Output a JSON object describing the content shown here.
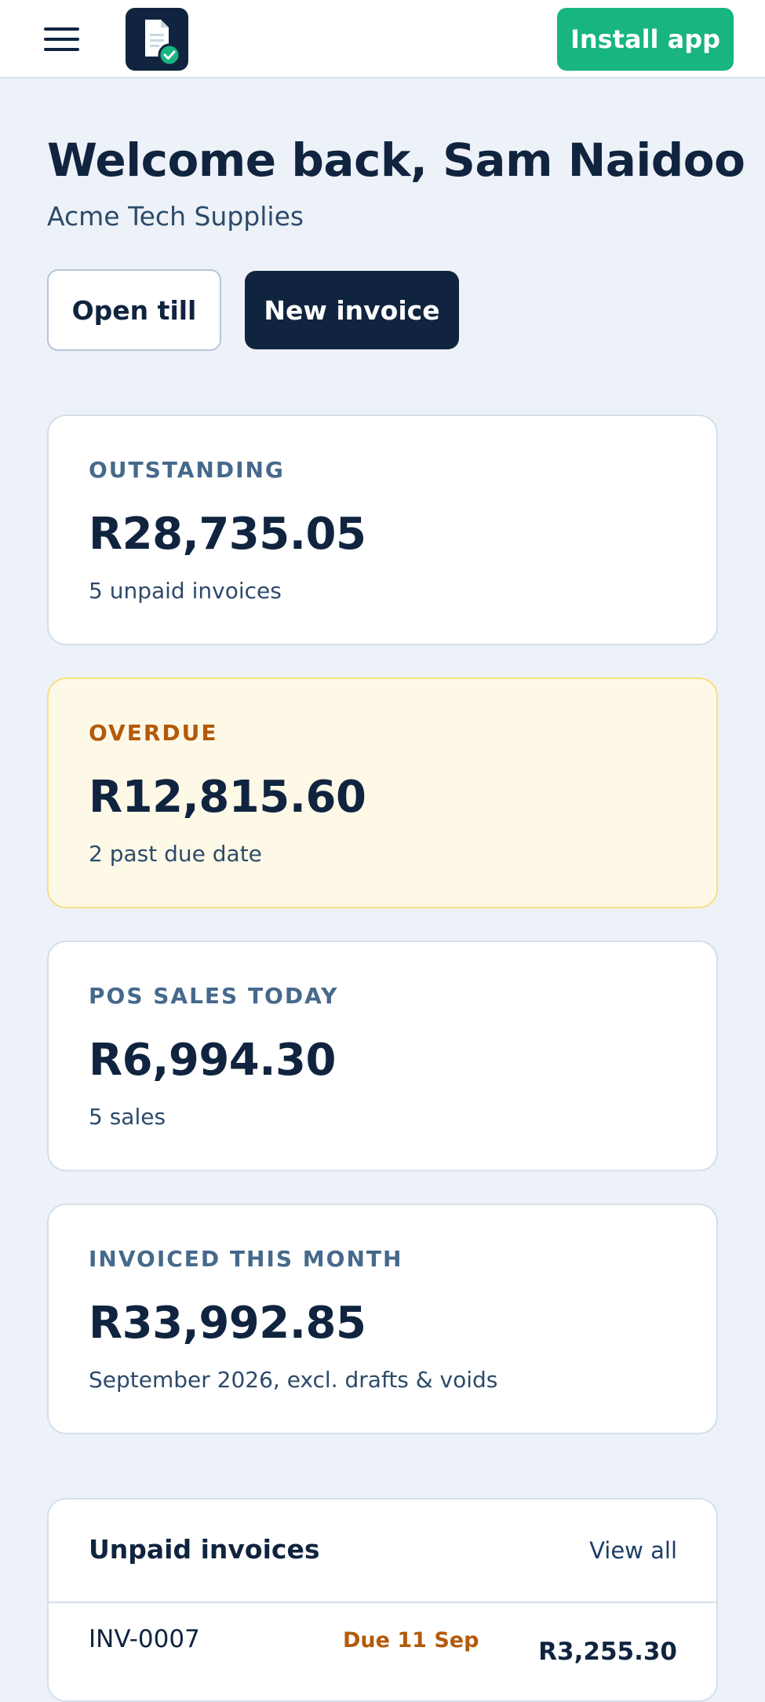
{
  "header": {
    "menu_icon": "hamburger-menu-icon",
    "logo_icon": "document-check-icon",
    "install_label": "Install app"
  },
  "greeting": {
    "title": "Welcome back, Sam Naidoo",
    "company": "Acme Tech Supplies"
  },
  "actions": {
    "open_till": "Open till",
    "new_invoice": "New invoice"
  },
  "stats": [
    {
      "label": "OUTSTANDING",
      "amount": "R28,735.05",
      "sub": "5 unpaid invoices"
    },
    {
      "label": "OVERDUE",
      "amount": "R12,815.60",
      "sub": "2 past due date"
    },
    {
      "label": "POS SALES TODAY",
      "amount": "R6,994.30",
      "sub": "5 sales"
    },
    {
      "label": "INVOICED THIS MONTH",
      "amount": "R33,992.85",
      "sub": "September 2026, excl. drafts & voids"
    }
  ],
  "unpaid": {
    "title": "Unpaid invoices",
    "view_all": "View all",
    "rows": [
      {
        "number": "INV-0007",
        "due": "Due 11 Sep",
        "amount": "R3,255.30"
      }
    ]
  },
  "colors": {
    "primary": "#10243f",
    "accent_green": "#18b57e",
    "background": "#edf2f8",
    "overdue_bg": "#fef9e7",
    "overdue_text": "#b35a0b",
    "label_text": "#46698c"
  }
}
